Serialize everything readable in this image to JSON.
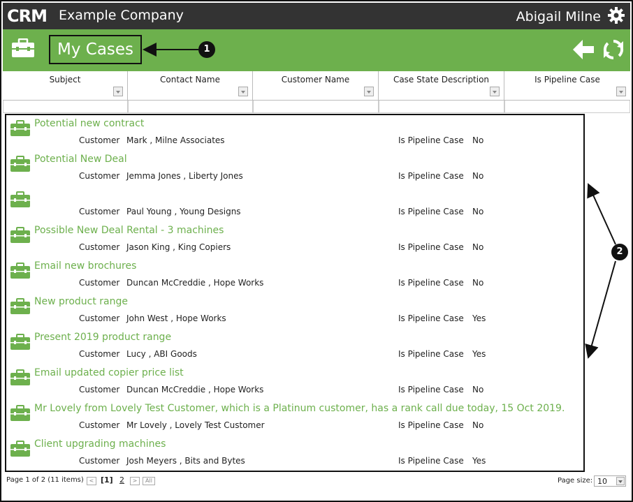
{
  "app": {
    "company": "Example Company",
    "user_name": "Abigail Milne",
    "page_title": "My Cases"
  },
  "columns": [
    "Subject",
    "Contact Name",
    "Customer Name",
    "Case State Description",
    "Is Pipeline Case"
  ],
  "cases": [
    {
      "subject": "Potential new contract",
      "customer_label": "Customer",
      "customer": "Mark , Milne Associates",
      "pipeline_label": "Is Pipeline Case",
      "pipeline": "No"
    },
    {
      "subject": "Potential New Deal",
      "customer_label": "Customer",
      "customer": "Jemma Jones , Liberty Jones",
      "pipeline_label": "Is Pipeline Case",
      "pipeline": "No"
    },
    {
      "subject": "",
      "customer_label": "Customer",
      "customer": "Paul Young , Young Designs",
      "pipeline_label": "Is Pipeline Case",
      "pipeline": "No"
    },
    {
      "subject": "Possible New Deal Rental - 3 machines",
      "customer_label": "Customer",
      "customer": "Jason King , King Copiers",
      "pipeline_label": "Is Pipeline Case",
      "pipeline": "No"
    },
    {
      "subject": "Email new brochures",
      "customer_label": "Customer",
      "customer": "Duncan McCreddie , Hope Works",
      "pipeline_label": "Is Pipeline Case",
      "pipeline": "No"
    },
    {
      "subject": "New product range",
      "customer_label": "Customer",
      "customer": "John West , Hope Works",
      "pipeline_label": "Is Pipeline Case",
      "pipeline": "Yes"
    },
    {
      "subject": "Present 2019 product range",
      "customer_label": "Customer",
      "customer": "Lucy , ABI Goods",
      "pipeline_label": "Is Pipeline Case",
      "pipeline": "Yes"
    },
    {
      "subject": "Email updated copier price list",
      "customer_label": "Customer",
      "customer": "Duncan McCreddie , Hope Works",
      "pipeline_label": "Is Pipeline Case",
      "pipeline": "No"
    },
    {
      "subject": "Mr Lovely from Lovely Test Customer, which is a Platinum customer, has a rank call due today, 15 Oct 2019.",
      "customer_label": "Customer",
      "customer": "Mr Lovely , Lovely Test Customer",
      "pipeline_label": "Is Pipeline Case",
      "pipeline": "No"
    },
    {
      "subject": "Client upgrading machines",
      "customer_label": "Customer",
      "customer": "Josh Meyers , Bits and Bytes",
      "pipeline_label": "Is Pipeline Case",
      "pipeline": "Yes"
    }
  ],
  "pager": {
    "summary": "Page 1 of 2 (11 items)",
    "prev": "<",
    "page1": "[1]",
    "page2": "2",
    "next": ">",
    "all": "All",
    "page_size_label": "Page size:",
    "page_size": "10"
  },
  "callouts": {
    "one": "1",
    "two": "2"
  },
  "colors": {
    "accent_green": "#6db04d",
    "header_dark": "#333333"
  },
  "icons": [
    "crm-logo",
    "gear-icon",
    "briefcase-icon",
    "back-arrow-icon",
    "refresh-icon",
    "filter-dropdown-icon"
  ]
}
